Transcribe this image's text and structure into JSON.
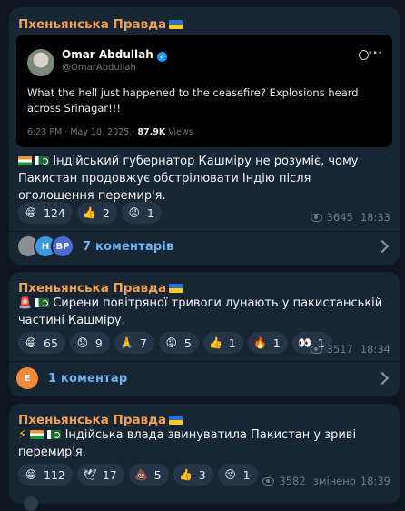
{
  "channel_name": "Пхеньянська Правда",
  "posts": [
    {
      "tweet": {
        "author": "Omar Abdullah",
        "handle": "@OmarAbdullah",
        "text": "What the hell just happened to the ceasefire? Explosions heard across Srinagar!!!",
        "time": "6:23 PM · May 10, 2025 ·",
        "views_count": "87.9K",
        "views_label": "Views"
      },
      "text": "Індійський губернатор Кашміру не розуміє, чому Пакистан продовжує обстрілювати Індію після оголошення перемир'я.",
      "reactions": [
        {
          "icon": "grinning-face",
          "glyph": "😁",
          "count": "124"
        },
        {
          "icon": "thumbs-up",
          "glyph": "👍",
          "count": "2"
        },
        {
          "icon": "enraged-face",
          "glyph": "😡",
          "count": "1"
        }
      ],
      "views": "3645",
      "time": "18:33",
      "comments": {
        "avatars": [
          "",
          "H",
          "BP"
        ],
        "label": "7 коментарів"
      }
    },
    {
      "text": "Сирени повітряної тривоги лунають у пакистанській частині Кашміру.",
      "reactions": [
        {
          "icon": "grinning-face",
          "glyph": "😁",
          "count": "65"
        },
        {
          "icon": "sad-face",
          "glyph": "😞",
          "count": "9"
        },
        {
          "icon": "folded-hands",
          "glyph": "🙏",
          "count": "7"
        },
        {
          "icon": "enraged-face",
          "glyph": "😡",
          "count": "5"
        },
        {
          "icon": "thumbs-up",
          "glyph": "👍",
          "count": "1"
        },
        {
          "icon": "fire",
          "glyph": "🔥",
          "count": "1"
        },
        {
          "icon": "eyes",
          "glyph": "👀",
          "count": "1"
        }
      ],
      "views": "3517",
      "time": "18:34",
      "comments": {
        "avatars": [
          "E"
        ],
        "label": "1 коментар"
      }
    },
    {
      "text": "Індійська влада звинуватила Пакистан у зриві перемир'я.",
      "reactions": [
        {
          "icon": "grinning-face",
          "glyph": "😁",
          "count": "112"
        },
        {
          "icon": "dove",
          "glyph": "🕊",
          "count": "17"
        },
        {
          "icon": "poop",
          "glyph": "💩",
          "count": "5"
        },
        {
          "icon": "thumbs-up",
          "glyph": "👍",
          "count": "3"
        },
        {
          "icon": "crying-face",
          "glyph": "😢",
          "count": "1"
        }
      ],
      "views": "3582",
      "edited": "змінено",
      "time": "18:39"
    }
  ]
}
